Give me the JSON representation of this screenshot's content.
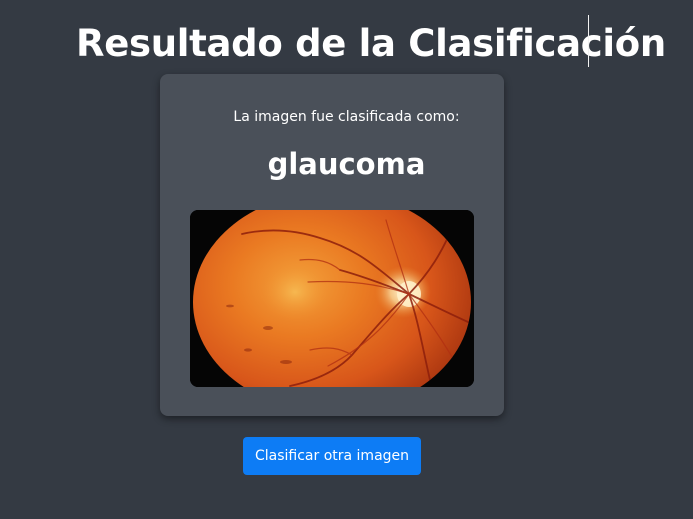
{
  "page": {
    "title": "Resultado de la Clasificación"
  },
  "result": {
    "caption": "La imagen fue clasificada como:",
    "label": "glaucoma"
  },
  "actions": {
    "classify_another_label": "Clasificar otra imagen"
  },
  "colors": {
    "background": "#343a43",
    "card": "#4a5059",
    "button": "#0d7cf5",
    "text": "#ffffff"
  }
}
